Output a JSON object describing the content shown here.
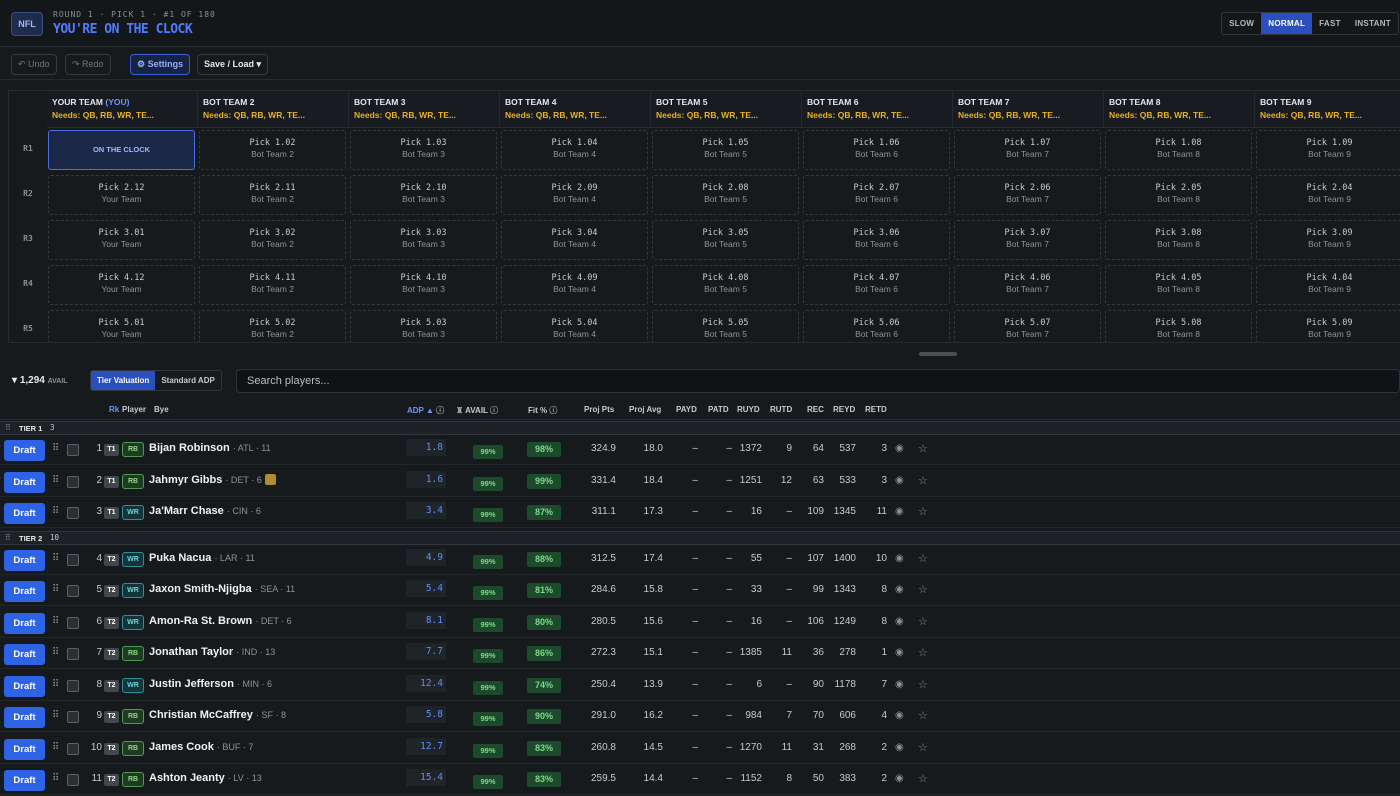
{
  "header": {
    "logo": "NFL",
    "round_line": "ROUND 1 · PICK 1 · #1 OF 180",
    "title": "YOU'RE ON THE CLOCK",
    "speeds": [
      {
        "label": "SLOW",
        "active": false
      },
      {
        "label": "NORMAL",
        "active": true
      },
      {
        "label": "FAST",
        "active": false
      },
      {
        "label": "INSTANT",
        "active": false
      }
    ]
  },
  "toolbar": {
    "undo": "↶ Undo",
    "redo": "↷ Redo",
    "settings": "⚙ Settings",
    "save_load": "Save / Load ▾"
  },
  "board": {
    "teams": [
      {
        "name": "YOUR TEAM",
        "suffix": "(YOU)",
        "needs": "Needs: QB, RB, WR, TE..."
      },
      {
        "name": "BOT TEAM 2",
        "suffix": "",
        "needs": "Needs: QB, RB, WR, TE..."
      },
      {
        "name": "BOT TEAM 3",
        "suffix": "",
        "needs": "Needs: QB, RB, WR, TE..."
      },
      {
        "name": "BOT TEAM 4",
        "suffix": "",
        "needs": "Needs: QB, RB, WR, TE..."
      },
      {
        "name": "BOT TEAM 5",
        "suffix": "",
        "needs": "Needs: QB, RB, WR, TE..."
      },
      {
        "name": "BOT TEAM 6",
        "suffix": "",
        "needs": "Needs: QB, RB, WR, TE..."
      },
      {
        "name": "BOT TEAM 7",
        "suffix": "",
        "needs": "Needs: QB, RB, WR, TE..."
      },
      {
        "name": "BOT TEAM 8",
        "suffix": "",
        "needs": "Needs: QB, RB, WR, TE..."
      },
      {
        "name": "BOT TEAM 9",
        "suffix": "",
        "needs": "Needs: QB, RB, WR, TE..."
      }
    ],
    "rounds": [
      {
        "label": "R1",
        "picks": [
          {
            "pick": "ON THE CLOCK",
            "team": "",
            "clock": true
          },
          {
            "pick": "Pick 1.02",
            "team": "Bot Team 2"
          },
          {
            "pick": "Pick 1.03",
            "team": "Bot Team 3"
          },
          {
            "pick": "Pick 1.04",
            "team": "Bot Team 4"
          },
          {
            "pick": "Pick 1.05",
            "team": "Bot Team 5"
          },
          {
            "pick": "Pick 1.06",
            "team": "Bot Team 6"
          },
          {
            "pick": "Pick 1.07",
            "team": "Bot Team 7"
          },
          {
            "pick": "Pick 1.08",
            "team": "Bot Team 8"
          },
          {
            "pick": "Pick 1.09",
            "team": "Bot Team 9"
          }
        ]
      },
      {
        "label": "R2",
        "picks": [
          {
            "pick": "Pick 2.12",
            "team": "Your Team"
          },
          {
            "pick": "Pick 2.11",
            "team": "Bot Team 2"
          },
          {
            "pick": "Pick 2.10",
            "team": "Bot Team 3"
          },
          {
            "pick": "Pick 2.09",
            "team": "Bot Team 4"
          },
          {
            "pick": "Pick 2.08",
            "team": "Bot Team 5"
          },
          {
            "pick": "Pick 2.07",
            "team": "Bot Team 6"
          },
          {
            "pick": "Pick 2.06",
            "team": "Bot Team 7"
          },
          {
            "pick": "Pick 2.05",
            "team": "Bot Team 8"
          },
          {
            "pick": "Pick 2.04",
            "team": "Bot Team 9"
          }
        ]
      },
      {
        "label": "R3",
        "picks": [
          {
            "pick": "Pick 3.01",
            "team": "Your Team"
          },
          {
            "pick": "Pick 3.02",
            "team": "Bot Team 2"
          },
          {
            "pick": "Pick 3.03",
            "team": "Bot Team 3"
          },
          {
            "pick": "Pick 3.04",
            "team": "Bot Team 4"
          },
          {
            "pick": "Pick 3.05",
            "team": "Bot Team 5"
          },
          {
            "pick": "Pick 3.06",
            "team": "Bot Team 6"
          },
          {
            "pick": "Pick 3.07",
            "team": "Bot Team 7"
          },
          {
            "pick": "Pick 3.08",
            "team": "Bot Team 8"
          },
          {
            "pick": "Pick 3.09",
            "team": "Bot Team 9"
          }
        ]
      },
      {
        "label": "R4",
        "picks": [
          {
            "pick": "Pick 4.12",
            "team": "Your Team"
          },
          {
            "pick": "Pick 4.11",
            "team": "Bot Team 2"
          },
          {
            "pick": "Pick 4.10",
            "team": "Bot Team 3"
          },
          {
            "pick": "Pick 4.09",
            "team": "Bot Team 4"
          },
          {
            "pick": "Pick 4.08",
            "team": "Bot Team 5"
          },
          {
            "pick": "Pick 4.07",
            "team": "Bot Team 6"
          },
          {
            "pick": "Pick 4.06",
            "team": "Bot Team 7"
          },
          {
            "pick": "Pick 4.05",
            "team": "Bot Team 8"
          },
          {
            "pick": "Pick 4.04",
            "team": "Bot Team 9"
          }
        ]
      },
      {
        "label": "R5",
        "picks": [
          {
            "pick": "Pick 5.01",
            "team": "Your Team"
          },
          {
            "pick": "Pick 5.02",
            "team": "Bot Team 2"
          },
          {
            "pick": "Pick 5.03",
            "team": "Bot Team 3"
          },
          {
            "pick": "Pick 5.04",
            "team": "Bot Team 4"
          },
          {
            "pick": "Pick 5.05",
            "team": "Bot Team 5"
          },
          {
            "pick": "Pick 5.06",
            "team": "Bot Team 6"
          },
          {
            "pick": "Pick 5.07",
            "team": "Bot Team 7"
          },
          {
            "pick": "Pick 5.08",
            "team": "Bot Team 8"
          },
          {
            "pick": "Pick 5.09",
            "team": "Bot Team 9"
          }
        ]
      }
    ]
  },
  "filters": {
    "avail_count": "1,294",
    "avail_label": "AVAIL",
    "modes": [
      {
        "label": "Tier Valuation",
        "active": true
      },
      {
        "label": "Standard ADP",
        "active": false
      }
    ],
    "search_placeholder": "Search players..."
  },
  "columns": {
    "rk": "Rk",
    "player": "Player",
    "bye": "Bye",
    "adp": "ADP ▲",
    "avail": "AVAIL",
    "fit": "Fit %",
    "projpts": "Proj Pts",
    "projavg": "Proj Avg",
    "payd": "PAYD",
    "patd": "PATD",
    "ruyd": "RUYD",
    "rutd": "RUTD",
    "rec": "REC",
    "reyd": "REYD",
    "retd": "RETD"
  },
  "tiers": [
    {
      "label": "TIER 1",
      "count": "3",
      "players": [
        {
          "rk": "1",
          "tier": "T1",
          "pos": "RB",
          "name": "Bijan Robinson",
          "meta": "· ATL · 11",
          "q": false,
          "adp": "1.8",
          "avail": "99%",
          "fit": "98%",
          "projpts": "324.9",
          "projavg": "18.0",
          "payd": "–",
          "patd": "–",
          "ruyd": "1372",
          "rutd": "9",
          "rec": "64",
          "reyd": "537",
          "retd": "3"
        },
        {
          "rk": "2",
          "tier": "T1",
          "pos": "RB",
          "name": "Jahmyr Gibbs",
          "meta": "· DET · 6",
          "q": true,
          "adp": "1.6",
          "avail": "99%",
          "fit": "99%",
          "projpts": "331.4",
          "projavg": "18.4",
          "payd": "–",
          "patd": "–",
          "ruyd": "1251",
          "rutd": "12",
          "rec": "63",
          "reyd": "533",
          "retd": "3"
        },
        {
          "rk": "3",
          "tier": "T1",
          "pos": "WR",
          "name": "Ja'Marr Chase",
          "meta": "· CIN · 6",
          "q": false,
          "adp": "3.4",
          "avail": "99%",
          "fit": "87%",
          "projpts": "311.1",
          "projavg": "17.3",
          "payd": "–",
          "patd": "–",
          "ruyd": "16",
          "rutd": "–",
          "rec": "109",
          "reyd": "1345",
          "retd": "11"
        }
      ]
    },
    {
      "label": "TIER 2",
      "count": "10",
      "players": [
        {
          "rk": "4",
          "tier": "T2",
          "pos": "WR",
          "name": "Puka Nacua",
          "meta": "· LAR · 11",
          "q": false,
          "adp": "4.9",
          "avail": "99%",
          "fit": "88%",
          "projpts": "312.5",
          "projavg": "17.4",
          "payd": "–",
          "patd": "–",
          "ruyd": "55",
          "rutd": "–",
          "rec": "107",
          "reyd": "1400",
          "retd": "10"
        },
        {
          "rk": "5",
          "tier": "T2",
          "pos": "WR",
          "name": "Jaxon Smith-Njigba",
          "meta": "· SEA · 11",
          "q": false,
          "adp": "5.4",
          "avail": "99%",
          "fit": "81%",
          "projpts": "284.6",
          "projavg": "15.8",
          "payd": "–",
          "patd": "–",
          "ruyd": "33",
          "rutd": "–",
          "rec": "99",
          "reyd": "1343",
          "retd": "8"
        },
        {
          "rk": "6",
          "tier": "T2",
          "pos": "WR",
          "name": "Amon-Ra St. Brown",
          "meta": "· DET · 6",
          "q": false,
          "adp": "8.1",
          "avail": "99%",
          "fit": "80%",
          "projpts": "280.5",
          "projavg": "15.6",
          "payd": "–",
          "patd": "–",
          "ruyd": "16",
          "rutd": "–",
          "rec": "106",
          "reyd": "1249",
          "retd": "8"
        },
        {
          "rk": "7",
          "tier": "T2",
          "pos": "RB",
          "name": "Jonathan Taylor",
          "meta": "· IND · 13",
          "q": false,
          "adp": "7.7",
          "avail": "99%",
          "fit": "86%",
          "projpts": "272.3",
          "projavg": "15.1",
          "payd": "–",
          "patd": "–",
          "ruyd": "1385",
          "rutd": "11",
          "rec": "36",
          "reyd": "278",
          "retd": "1"
        },
        {
          "rk": "8",
          "tier": "T2",
          "pos": "WR",
          "name": "Justin Jefferson",
          "meta": "· MIN · 6",
          "q": false,
          "adp": "12.4",
          "avail": "99%",
          "fit": "74%",
          "projpts": "250.4",
          "projavg": "13.9",
          "payd": "–",
          "patd": "–",
          "ruyd": "6",
          "rutd": "–",
          "rec": "90",
          "reyd": "1178",
          "retd": "7"
        },
        {
          "rk": "9",
          "tier": "T2",
          "pos": "RB",
          "name": "Christian McCaffrey",
          "meta": "· SF · 8",
          "q": false,
          "adp": "5.8",
          "avail": "99%",
          "fit": "90%",
          "projpts": "291.0",
          "projavg": "16.2",
          "payd": "–",
          "patd": "–",
          "ruyd": "984",
          "rutd": "7",
          "rec": "70",
          "reyd": "606",
          "retd": "4"
        },
        {
          "rk": "10",
          "tier": "T2",
          "pos": "RB",
          "name": "James Cook",
          "meta": "· BUF · 7",
          "q": false,
          "adp": "12.7",
          "avail": "99%",
          "fit": "83%",
          "projpts": "260.8",
          "projavg": "14.5",
          "payd": "–",
          "patd": "–",
          "ruyd": "1270",
          "rutd": "11",
          "rec": "31",
          "reyd": "268",
          "retd": "2"
        },
        {
          "rk": "11",
          "tier": "T2",
          "pos": "RB",
          "name": "Ashton Jeanty",
          "meta": "· LV · 13",
          "q": false,
          "adp": "15.4",
          "avail": "99%",
          "fit": "83%",
          "projpts": "259.5",
          "projavg": "14.4",
          "payd": "–",
          "patd": "–",
          "ruyd": "1152",
          "rutd": "8",
          "rec": "50",
          "reyd": "383",
          "retd": "2"
        }
      ]
    }
  ],
  "draft_label": "Draft"
}
